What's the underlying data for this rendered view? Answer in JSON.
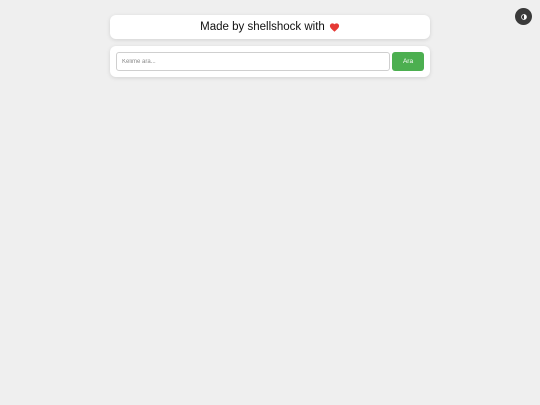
{
  "header": {
    "text": "Made by shellshock with",
    "heart_icon": "heart-icon",
    "heart_color": "#e53935"
  },
  "search": {
    "placeholder": "Kelime ara...",
    "value": "",
    "button_label": "Ara",
    "button_color": "#4caf50"
  },
  "theme_toggle": {
    "icon": "half-moon-contrast-icon",
    "background_color": "#3a3a3a"
  },
  "page": {
    "background_color": "#efefef"
  }
}
